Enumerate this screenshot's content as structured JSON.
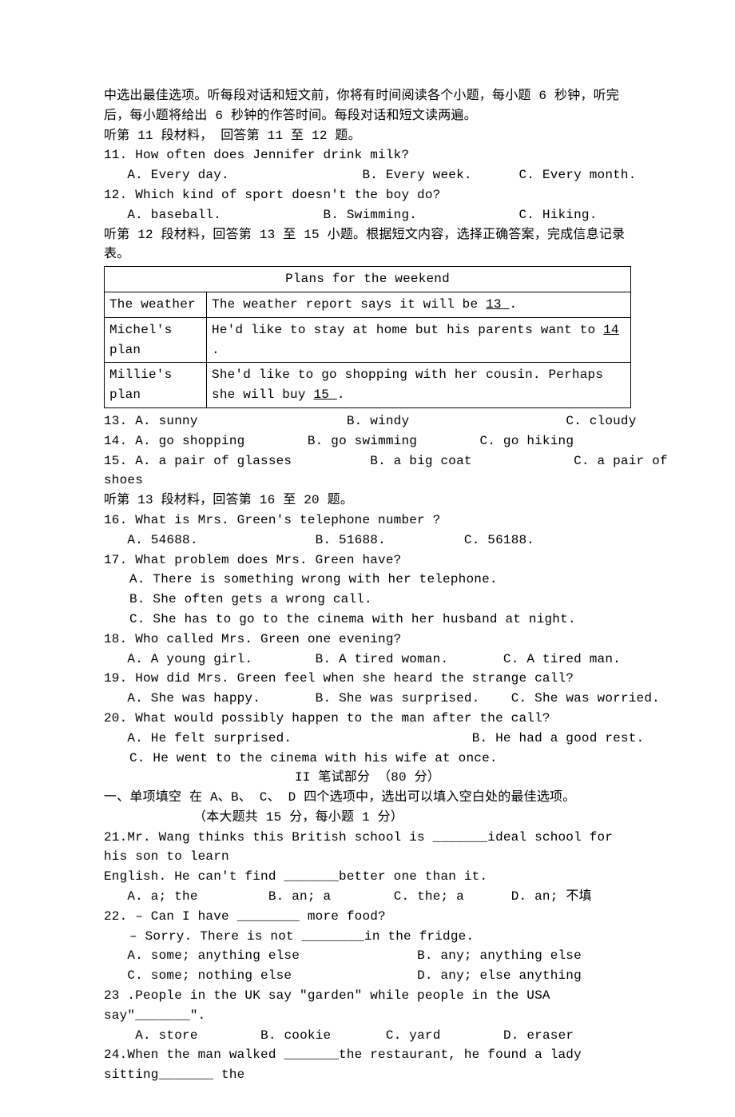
{
  "intro": {
    "line1": "中选出最佳选项。听每段对话和短文前，你将有时间阅读各个小题，每小题 6 秒钟，听完",
    "line2": "后，每小题将给出 6 秒钟的作答时间。每段对话和短文读两遍。",
    "seg11": "听第 11 段材料， 回答第 11 至 12 题。"
  },
  "q11": {
    "stem": "11. How often does Jennifer drink milk?",
    "a": "A. Every day.",
    "b": "B. Every week.",
    "c": "C. Every month."
  },
  "q12": {
    "stem": "12. Which kind of sport doesn't the boy do?",
    "a": "A. baseball.",
    "b": "B. Swimming.",
    "c": "C. Hiking."
  },
  "seg12": "听第 12 段材料，回答第 13 至 15 小题。根据短文内容，选择正确答案，完成信息记录表。",
  "table": {
    "title": "Plans for the weekend",
    "r1c1": "The weather",
    "r1c2a": "The weather report says it will be ",
    "r1c2b": "  13  ",
    "r1c2c": ".",
    "r2c1": "Michel's plan",
    "r2c2a": "He'd like to stay at home but his parents want to ",
    "r2c2b": "  14  ",
    "r2c2c": ".",
    "r3c1": "Millie's plan",
    "r3c2a": "She'd like to go shopping with her cousin. Perhaps she will buy ",
    "r3c2b": " 15  ",
    "r3c2c": "."
  },
  "q13": {
    "a": "13. A. sunny",
    "b": "B. windy",
    "c": "C. cloudy"
  },
  "q14": {
    "a": "14. A. go shopping",
    "b": "B. go swimming",
    "c": "C. go hiking"
  },
  "q15": {
    "a": "15. A. a pair of glasses",
    "b": "B. a big coat",
    "c": "C. a pair of",
    "tail": "shoes"
  },
  "seg13": "听第 13 段材料，回答第 16 至 20 题。",
  "q16": {
    "stem": "16. What is Mrs. Green's telephone number ?",
    "a": "A. 54688.",
    "b": "B. 51688.",
    "c": "C. 56188."
  },
  "q17": {
    "stem": "17. What problem does Mrs. Green have?",
    "a": "A. There is something wrong with her telephone.",
    "b": "B. She often gets a wrong call.",
    "c": "C. She has to go to the cinema with her husband at night."
  },
  "q18": {
    "stem": "18. Who called Mrs. Green one evening?",
    "a": "A. A young girl.",
    "b": "B. A tired woman.",
    "c": "C. A tired man."
  },
  "q19": {
    "stem": "19. How did Mrs. Green feel when she heard the strange call?",
    "a": "A. She was happy.",
    "b": "B. She was surprised.",
    "c": "C. She was worried."
  },
  "q20": {
    "stem": "20. What would possibly happen to the man after the call?",
    "a": "A. He felt surprised.",
    "b": "B. He had a good rest.",
    "c": "C. He went to the cinema with his wife at once."
  },
  "part2": {
    "header": "II  笔试部分  （80 分）",
    "sec1a": "一、单项填空 在 A、B、 C、 D 四个选项中，选出可以填入空白处的最佳选项。",
    "sec1b": "（本大题共 15 分，每小题 1 分）"
  },
  "q21": {
    "line1": "21.Mr. Wang thinks this British school is _______ideal school for his son to learn",
    "line2": " English. He can't find _______better one than it.",
    "a": "A. a; the",
    "b": "B. an; a",
    "c": "C. the; a",
    "d": "D. an; 不填"
  },
  "q22": {
    "stem": "22. – Can I have ________ more food?",
    "line2": "– Sorry. There is not ________in the fridge.",
    "a": "A. some; anything else",
    "b": "B. any; anything else",
    "c": "C. some; nothing else",
    "d": "D. any; else anything"
  },
  "q23": {
    "stem": "23 .People in the UK say \"garden\" while people in the USA say\"_______\".",
    "a": "A. store",
    "b": "B. cookie",
    "c": "C. yard",
    "d": "D. eraser"
  },
  "q24": {
    "stem": "24.When the man walked _______the restaurant, he found a lady sitting_______ the"
  }
}
